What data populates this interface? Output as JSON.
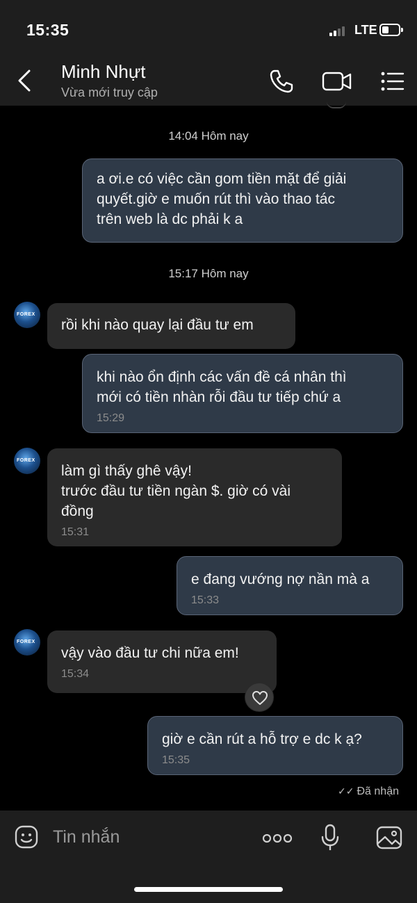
{
  "status_bar": {
    "time": "15:35",
    "network": "LTE"
  },
  "header": {
    "contact_name": "Minh Nhựt",
    "contact_status": "Vừa mới truy cập",
    "icons": [
      "back-icon",
      "phone-icon",
      "video-call-icon",
      "menu-icon"
    ]
  },
  "chat": {
    "dividers": [
      "14:04 Hôm nay",
      "15:17 Hôm nay"
    ],
    "messages": [
      {
        "direction": "out",
        "text": "a ơi.e có việc cần gom tiền mặt để giải\nquyết.giờ e muốn rút thì vào thao tác\ntrên web là dc phải k a",
        "time": ""
      },
      {
        "direction": "in",
        "text": "rồi khi nào quay lại đầu tư em",
        "time": ""
      },
      {
        "direction": "out",
        "text": "khi nào ổn định các vấn đề cá nhân thì\nmới có tiền nhàn rỗi đầu tư tiếp chứ a",
        "time": "15:29"
      },
      {
        "direction": "in",
        "text": "làm gì thấy ghê vậy!\ntrước đầu tư tiền ngàn $. giờ có vài\nđồng",
        "time": "15:31"
      },
      {
        "direction": "out",
        "text": "e đang vướng nợ nần mà a",
        "time": "15:33"
      },
      {
        "direction": "in",
        "text": "vậy vào đầu tư chi nữa em!",
        "time": "15:34"
      },
      {
        "direction": "out",
        "text": "giờ e cần rút a hỗ trợ e dc k ạ?",
        "time": "15:35"
      }
    ],
    "avatar_logo": "FOREX",
    "delivery_status": "Đã nhận"
  },
  "composer": {
    "placeholder": "Tin nhắn",
    "icons": [
      "sticker-icon",
      "more-icon",
      "microphone-icon",
      "image-icon"
    ]
  },
  "colors": {
    "header_bg": "#1e1e1e",
    "outgoing_bubble": "#2f3a48",
    "incoming_bubble": "#2a2a2a",
    "background": "#000000"
  }
}
